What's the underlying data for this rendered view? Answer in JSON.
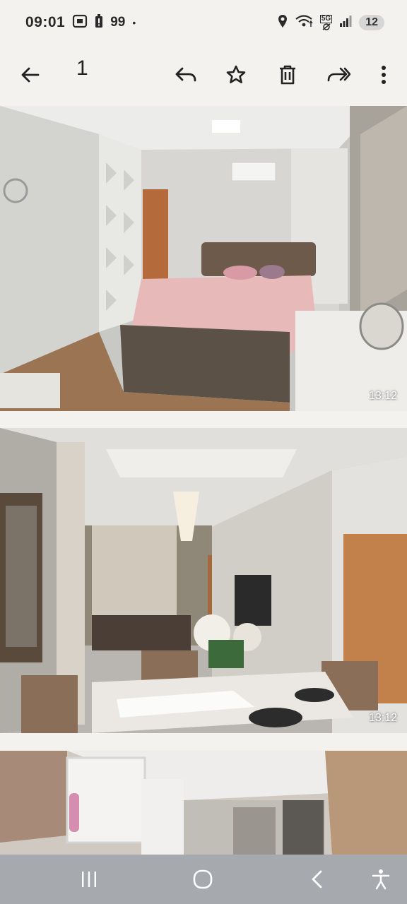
{
  "status_bar": {
    "time": "09:01",
    "battery": "99",
    "separator_dot": "•",
    "network": "5G",
    "notifications_badge": "12"
  },
  "toolbar": {
    "photo_count": "1",
    "icons": [
      "back-arrow-icon",
      "reply-icon",
      "star-icon",
      "delete-icon",
      "forward-icon",
      "more-vert-icon"
    ]
  },
  "photos": [
    {
      "time": "13:12"
    },
    {
      "time": "13:12"
    }
  ],
  "nav_bar": {
    "icons": [
      "recent-apps-icon",
      "home-icon",
      "back-icon",
      "accessibility-icon"
    ]
  },
  "colors": {
    "background": "#f3f2ef",
    "nav_bar": "#a6a9ad"
  }
}
